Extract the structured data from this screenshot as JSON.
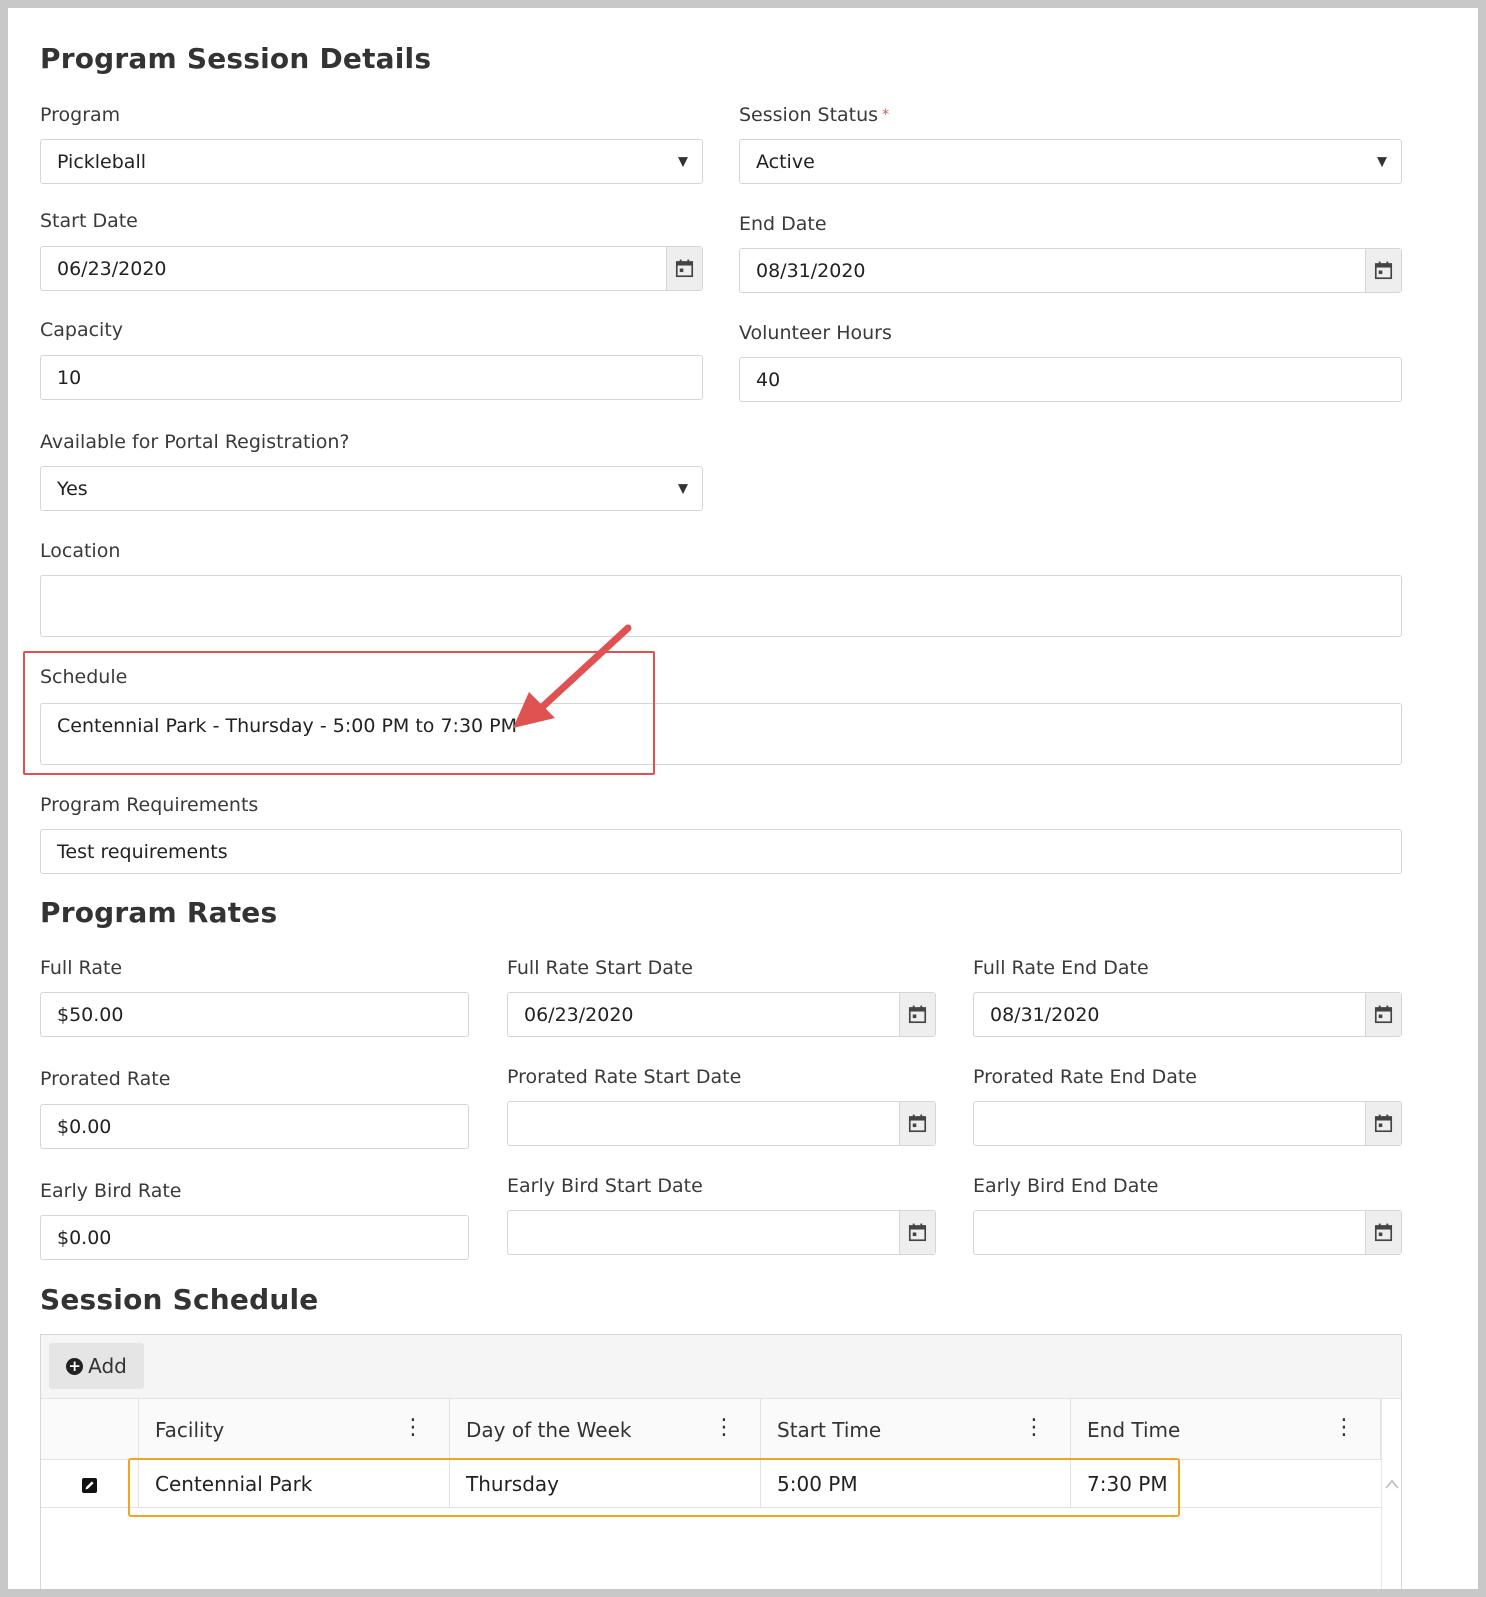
{
  "details": {
    "title": "Program Session Details",
    "program": {
      "label": "Program",
      "value": "Pickleball"
    },
    "session_status": {
      "label": "Session Status",
      "required_mark": "*",
      "value": "Active"
    },
    "start_date": {
      "label": "Start Date",
      "value": "06/23/2020"
    },
    "end_date": {
      "label": "End Date",
      "value": "08/31/2020"
    },
    "capacity": {
      "label": "Capacity",
      "value": "10"
    },
    "volunteer_hours": {
      "label": "Volunteer Hours",
      "value": "40"
    },
    "portal": {
      "label": "Available for Portal Registration?",
      "value": "Yes"
    },
    "location": {
      "label": "Location",
      "value": ""
    },
    "schedule": {
      "label": "Schedule",
      "value": "Centennial Park - Thursday - 5:00 PM to 7:30 PM"
    },
    "requirements": {
      "label": "Program Requirements",
      "value": "Test requirements"
    }
  },
  "rates": {
    "title": "Program Rates",
    "full_rate": {
      "label": "Full Rate",
      "value": "$50.00"
    },
    "full_rate_start": {
      "label": "Full Rate Start Date",
      "value": "06/23/2020"
    },
    "full_rate_end": {
      "label": "Full Rate End Date",
      "value": "08/31/2020"
    },
    "prorated_rate": {
      "label": "Prorated Rate",
      "value": "$0.00"
    },
    "prorated_start": {
      "label": "Prorated Rate Start Date",
      "value": ""
    },
    "prorated_end": {
      "label": "Prorated Rate End Date",
      "value": ""
    },
    "early_rate": {
      "label": "Early Bird Rate",
      "value": "$0.00"
    },
    "early_start": {
      "label": "Early Bird Start Date",
      "value": ""
    },
    "early_end": {
      "label": "Early Bird End Date",
      "value": ""
    }
  },
  "session_schedule": {
    "title": "Session Schedule",
    "add_label": "Add",
    "columns": [
      "Facility",
      "Day of the Week",
      "Start Time",
      "End Time"
    ],
    "rows": [
      {
        "facility": "Centennial Park",
        "day": "Thursday",
        "start": "5:00 PM",
        "end": "7:30 PM"
      }
    ]
  },
  "colors": {
    "annotation_red": "#e05252",
    "annotation_orange": "#f0a522"
  },
  "icons": {
    "calendar": "calendar-icon",
    "dropdown": "caret-down-icon",
    "add": "plus-circle-icon",
    "edit": "edit-icon",
    "column_menu": "kebab-menu-icon",
    "annotation": "red-arrow-annotation"
  }
}
